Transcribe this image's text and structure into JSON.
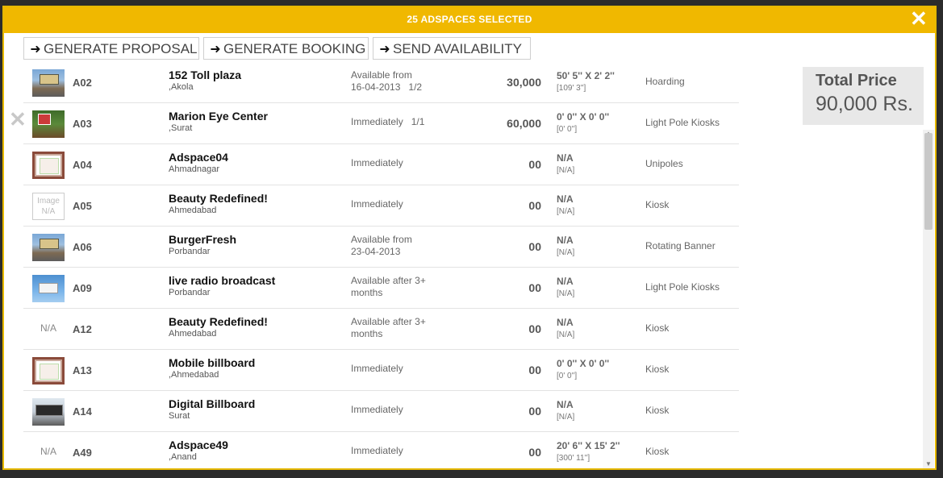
{
  "header": {
    "title": "25 ADSPACES SELECTED"
  },
  "actions": [
    {
      "label": "GENERATE PROPOSAL"
    },
    {
      "label": "GENERATE BOOKING"
    },
    {
      "label": "SEND AVAILABILITY"
    }
  ],
  "rows": [
    {
      "thumb": "billboard",
      "code": "A02",
      "name": "152 Toll plaza",
      "location": ",Akola",
      "availability": "Available from",
      "availability2": "16-04-2013",
      "qty": "1/2",
      "price": "30,000",
      "size": "50' 5'' X 2' 2''",
      "size_sub": "[109' 3'']",
      "type": "Hoarding"
    },
    {
      "thumb": "tree",
      "code": "A03",
      "name": "Marion Eye Center",
      "location": ",Surat",
      "availability": "Immediately",
      "qty": "1/1",
      "price": "60,000",
      "size": "0' 0'' X 0' 0''",
      "size_sub": "[0' 0'']",
      "type": "Light Pole Kiosks"
    },
    {
      "thumb": "frame",
      "code": "A04",
      "name": "Adspace04",
      "location": "Ahmadnagar",
      "availability": "Immediately",
      "price": "00",
      "size": "N/A",
      "size_sub": "[N/A]",
      "type": "Unipoles"
    },
    {
      "thumb": "image-na",
      "thumb_text": "Image N/A",
      "code": "A05",
      "name": "Beauty Redefined!",
      "location": "Ahmedabad",
      "availability": "Immediately",
      "price": "00",
      "size": "N/A",
      "size_sub": "[N/A]",
      "type": "Kiosk"
    },
    {
      "thumb": "billboard",
      "code": "A06",
      "name": "BurgerFresh",
      "location": "Porbandar",
      "availability": "Available from",
      "availability2": "23-04-2013",
      "price": "00",
      "size": "N/A",
      "size_sub": "[N/A]",
      "type": "Rotating Banner"
    },
    {
      "thumb": "sky",
      "code": "A09",
      "name": "live radio broadcast",
      "location": "Porbandar",
      "availability": "Available after 3+",
      "availability2": "months",
      "price": "00",
      "size": "N/A",
      "size_sub": "[N/A]",
      "type": "Light Pole Kiosks"
    },
    {
      "thumb": "text",
      "thumb_text": "N/A",
      "code": "A12",
      "name": "Beauty Redefined!",
      "location": "Ahmedabad",
      "availability": "Available after 3+",
      "availability2": "months",
      "price": "00",
      "size": "N/A",
      "size_sub": "[N/A]",
      "type": "Kiosk"
    },
    {
      "thumb": "frame",
      "code": "A13",
      "name": "Mobile billboard",
      "location": ",Ahmedabad",
      "availability": "Immediately",
      "price": "00",
      "size": "0' 0'' X 0' 0''",
      "size_sub": "[0' 0'']",
      "type": "Kiosk"
    },
    {
      "thumb": "digital",
      "code": "A14",
      "name": "Digital Billboard",
      "location": "Surat",
      "availability": "Immediately",
      "price": "00",
      "size": "N/A",
      "size_sub": "[N/A]",
      "type": "Kiosk"
    },
    {
      "thumb": "text",
      "thumb_text": "N/A",
      "code": "A49",
      "name": "Adspace49",
      "location": ",Anand",
      "availability": "Immediately",
      "price": "00",
      "size": "20' 6'' X 15' 2''",
      "size_sub": "[300' 11'']",
      "type": "Kiosk"
    }
  ],
  "total": {
    "label": "Total Price",
    "value": "90,000 Rs."
  }
}
